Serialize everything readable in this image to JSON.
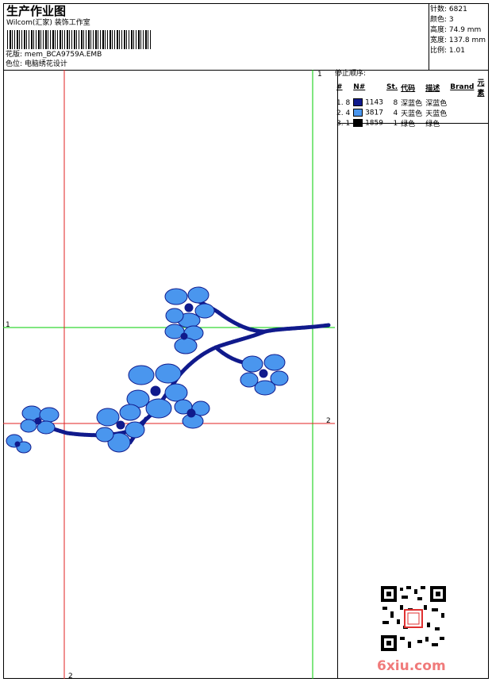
{
  "header": {
    "title": "生产作业图",
    "subtitle": "Wilcom(汇家) 装饰工作室",
    "design_label": "花版:",
    "design_file": "mem_BCA9759A.EMB",
    "color_label": "色位:",
    "color_value": "电脑绣花设计"
  },
  "stats": {
    "stitches": "针数: 6821",
    "colors": "颜色: 3",
    "height": "高度: 74.9 mm",
    "width": "宽度: 137.8 mm",
    "scale": "比例: 1.01"
  },
  "stop_sequence": {
    "title": "停止顺序:",
    "headers": [
      "#",
      "N#",
      "St.",
      "代码",
      "描述",
      "Brand",
      "元素"
    ],
    "rows": [
      {
        "idx": "1. 8",
        "code": "1143",
        "st": "8",
        "desc": "深蓝色",
        "brand": "深蓝色",
        "color": "#101a8c"
      },
      {
        "idx": "2. 4",
        "code": "3817",
        "st": "4",
        "desc": "天蓝色",
        "brand": "天蓝色",
        "color": "#4a96ee"
      },
      {
        "idx": "3. 1",
        "code": "1859",
        "st": "1",
        "desc": "绿色",
        "brand": "绿色",
        "color": "#000000"
      }
    ]
  },
  "guides": {
    "green_v_label": "1",
    "green_h_label": "1",
    "red_h_label": "2",
    "red_v_label": "2"
  },
  "watermark": "6xiu.com",
  "colors": {
    "green": "#00cc00",
    "red": "#e02020",
    "dark_blue": "#101a8c",
    "sky_blue": "#4a96ee"
  }
}
